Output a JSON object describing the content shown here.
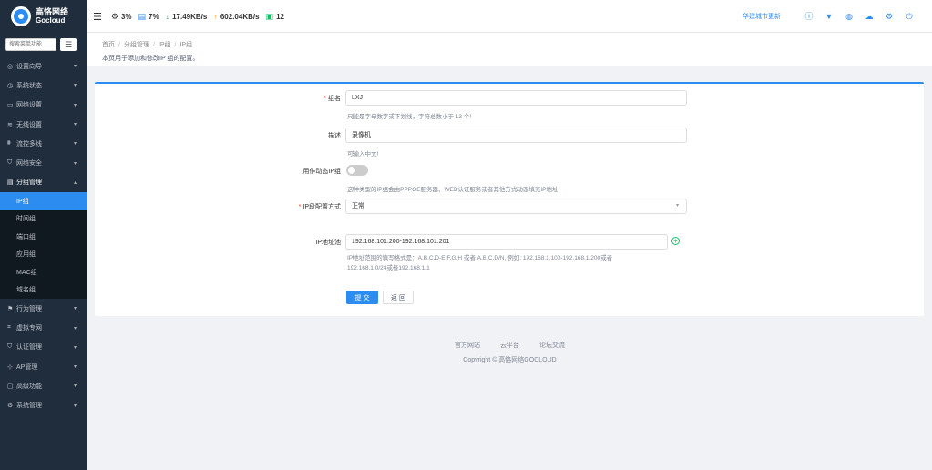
{
  "topbar": {
    "logo_cn": "高恪网络",
    "logo_en": "Gocloud",
    "cpu": "3%",
    "mem": "7%",
    "down": "17.49KB/s",
    "up": "602.04KB/s",
    "online": "12",
    "update_link": "华建城市更新",
    "icons": [
      "info-icon",
      "shirt-icon",
      "globe-icon",
      "cloud-download-icon",
      "gear-icon",
      "exit-icon"
    ]
  },
  "sidebar": {
    "search_placeholder": "搜索菜单功能",
    "items": [
      {
        "label": "设置向导",
        "icon": "wizard-icon"
      },
      {
        "label": "系统状态",
        "icon": "clock-icon"
      },
      {
        "label": "网络设置",
        "icon": "monitor-icon"
      },
      {
        "label": "无线设置",
        "icon": "wifi-icon"
      },
      {
        "label": "流控多线",
        "icon": "flow-icon"
      },
      {
        "label": "网络安全",
        "icon": "shield-icon"
      },
      {
        "label": "分组管理",
        "icon": "doc-icon"
      }
    ],
    "sub_items": [
      "IP组",
      "时间组",
      "端口组",
      "应用组",
      "MAC组",
      "域名组"
    ],
    "items_after": [
      {
        "label": "行为管理",
        "icon": "behavior-icon"
      },
      {
        "label": "虚拟专网",
        "icon": "vpn-icon"
      },
      {
        "label": "认证管理",
        "icon": "auth-icon"
      },
      {
        "label": "AP管理",
        "icon": "ap-icon"
      },
      {
        "label": "高级功能",
        "icon": "advanced-icon"
      },
      {
        "label": "系统管理",
        "icon": "system-icon"
      }
    ]
  },
  "breadcrumb": [
    "首页",
    "分组管理",
    "IP组",
    "IP组"
  ],
  "page_desc": "本页用于添加和修改IP 组的配置。",
  "form": {
    "name_label": "组名",
    "name_value": "LXJ",
    "name_hint": "只能是字母数字或下划线，字符总数小于 13 个!",
    "desc_label": "描述",
    "desc_value": "录像机",
    "desc_hint": "可输入中文!",
    "dynamic_label": "用作动态IP组",
    "dynamic_hint": "这种类型的IP组会由PPPOE服务器、WEB认证服务或者其他方式动态填充IP地址",
    "mode_label": "IP段配置方式",
    "mode_value": "正常",
    "ip_label": "IP地址池",
    "ip_value": "192.168.101.200-192.168.101.201",
    "ip_hint_1": "IP地址范围的填写格式是：A.B.C.D-E.F.G.H 或者 A.B.C.D/N, 例如: 192.168.1.100-192.168.1.200或者",
    "ip_hint_2": "192.168.1.0/24或者192.168.1.1",
    "submit_label": "提 交",
    "back_label": "返 回"
  },
  "footer": {
    "links": [
      "官方网站",
      "云平台",
      "论坛交流"
    ],
    "copyright": "Copyright © 高恪网络GOCLOUD"
  }
}
